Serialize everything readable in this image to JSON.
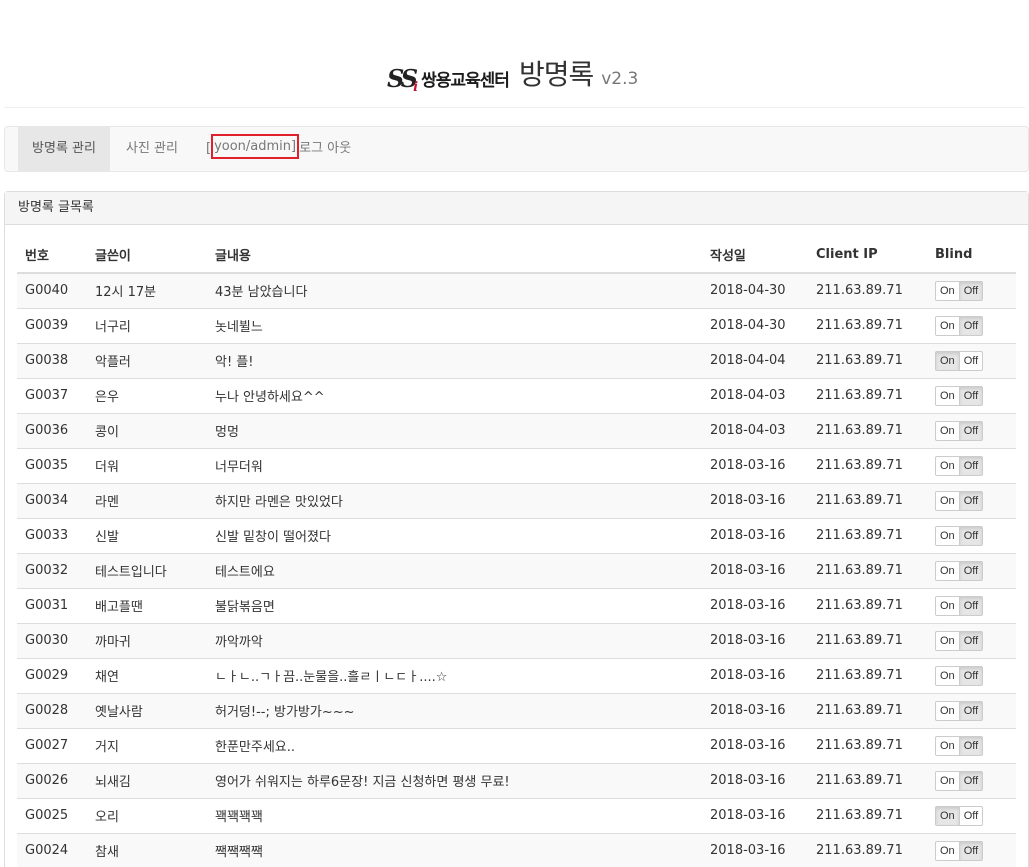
{
  "header": {
    "logo_mark": "SS",
    "logo_mark_sub": "i",
    "logo_text": "쌍용교육센터",
    "title": "방명록",
    "version": "v2.3"
  },
  "nav": {
    "manage": "방명록 관리",
    "photo": "사진 관리",
    "user_bracket_open": "[",
    "user_name": "yoon/admin]",
    "logout": "로그 아웃"
  },
  "panel": {
    "title": "방명록 글목록"
  },
  "table": {
    "headers": {
      "no": "번호",
      "writer": "글쓴이",
      "content": "글내용",
      "date": "작성일",
      "ip": "Client IP",
      "blind": "Blind"
    },
    "toggle": {
      "on": "On",
      "off": "Off"
    },
    "rows": [
      {
        "no": "G0040",
        "writer": "12시 17분",
        "content": "43분 남았습니다",
        "date": "2018-04-30",
        "ip": "211.63.89.71",
        "blind": "off"
      },
      {
        "no": "G0039",
        "writer": "너구리",
        "content": "놋네뷜느",
        "date": "2018-04-30",
        "ip": "211.63.89.71",
        "blind": "off"
      },
      {
        "no": "G0038",
        "writer": "악플러",
        "content": "악! 플!",
        "date": "2018-04-04",
        "ip": "211.63.89.71",
        "blind": "on"
      },
      {
        "no": "G0037",
        "writer": "은우",
        "content": "누나 안녕하세요^^",
        "date": "2018-04-03",
        "ip": "211.63.89.71",
        "blind": "off"
      },
      {
        "no": "G0036",
        "writer": "콩이",
        "content": "멍멍",
        "date": "2018-04-03",
        "ip": "211.63.89.71",
        "blind": "off"
      },
      {
        "no": "G0035",
        "writer": "더워",
        "content": "너무더워",
        "date": "2018-03-16",
        "ip": "211.63.89.71",
        "blind": "off"
      },
      {
        "no": "G0034",
        "writer": "라멘",
        "content": "하지만 라멘은 맛있었다",
        "date": "2018-03-16",
        "ip": "211.63.89.71",
        "blind": "off"
      },
      {
        "no": "G0033",
        "writer": "신발",
        "content": "신발 밑창이 떨어졌다",
        "date": "2018-03-16",
        "ip": "211.63.89.71",
        "blind": "off"
      },
      {
        "no": "G0032",
        "writer": "테스트입니다",
        "content": "테스트에요",
        "date": "2018-03-16",
        "ip": "211.63.89.71",
        "blind": "off"
      },
      {
        "no": "G0031",
        "writer": "배고플땐",
        "content": "불닭볶음면",
        "date": "2018-03-16",
        "ip": "211.63.89.71",
        "blind": "off"
      },
      {
        "no": "G0030",
        "writer": "까마귀",
        "content": "까악까악",
        "date": "2018-03-16",
        "ip": "211.63.89.71",
        "blind": "off"
      },
      {
        "no": "G0029",
        "writer": "채연",
        "content": "ㄴㅏㄴ..ㄱㅏ끔..눈물을..흘ㄹㅣㄴㄷㅏ....☆",
        "date": "2018-03-16",
        "ip": "211.63.89.71",
        "blind": "off"
      },
      {
        "no": "G0028",
        "writer": "옛날사람",
        "content": "허거덩!--; 방가방가~~~",
        "date": "2018-03-16",
        "ip": "211.63.89.71",
        "blind": "off"
      },
      {
        "no": "G0027",
        "writer": "거지",
        "content": "한푼만주세요..",
        "date": "2018-03-16",
        "ip": "211.63.89.71",
        "blind": "off"
      },
      {
        "no": "G0026",
        "writer": "뇌새김",
        "content": "영어가 쉬워지는 하루6문장! 지금 신청하면 평생 무료!",
        "date": "2018-03-16",
        "ip": "211.63.89.71",
        "blind": "off"
      },
      {
        "no": "G0025",
        "writer": "오리",
        "content": "꽥꽥꽥꽥",
        "date": "2018-03-16",
        "ip": "211.63.89.71",
        "blind": "on"
      },
      {
        "no": "G0024",
        "writer": "참새",
        "content": "짹짹짹짹",
        "date": "2018-03-16",
        "ip": "211.63.89.71",
        "blind": "off"
      }
    ]
  }
}
